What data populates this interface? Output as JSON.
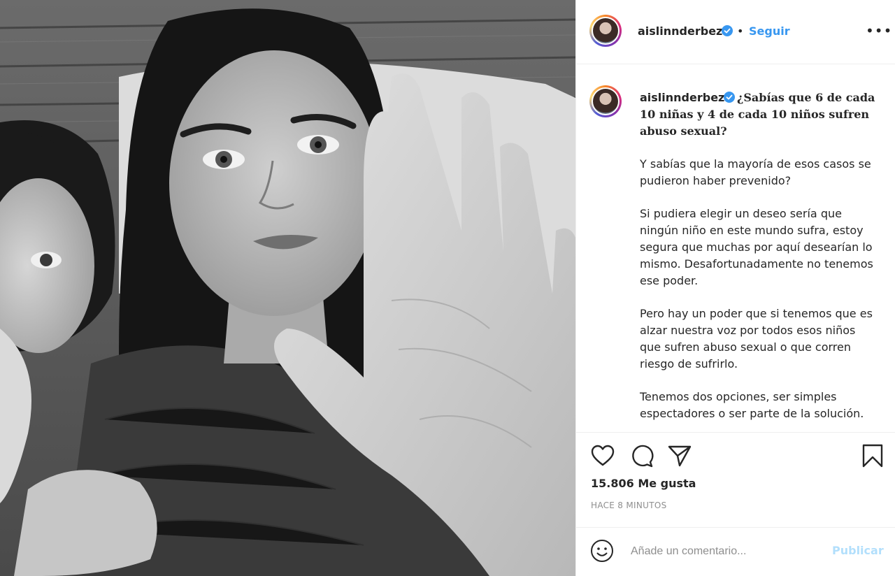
{
  "post": {
    "username": "aislinnderbez",
    "verified": true,
    "follow_label": "Seguir",
    "separator": "•",
    "more_label": "•••"
  },
  "caption": {
    "username": "aislinnderbez",
    "paragraphs": [
      "¿Sabías que 6 de cada 10 niñas y 4 de cada 10 niños sufren abuso sexual?",
      "Y sabías que la mayoría de esos casos se pudieron haber prevenido?",
      "Si pudiera elegir un deseo sería que ningún niño en este mundo sufra, estoy segura que muchas por aquí desearían lo mismo. Desafortunadamente no tenemos ese poder.",
      "Pero hay un poder que si tenemos que es alzar nuestra voz por todos esos niños que sufren abuso sexual o que corren riesgo de sufrirlo.",
      "Tenemos dos opciones, ser simples espectadores o ser parte de la solución."
    ]
  },
  "actions": {
    "like_icon": "heart-icon",
    "comment_icon": "comment-icon",
    "share_icon": "share-icon",
    "save_icon": "bookmark-icon"
  },
  "likes_text": "15.806 Me gusta",
  "timestamp": "HACE 8 MINUTOS",
  "comment": {
    "placeholder": "Añade un comentario...",
    "publish_label": "Publicar",
    "emoji_icon": "emoji-icon"
  },
  "colors": {
    "link_blue": "#3897f0",
    "publish_disabled": "#b2dffc",
    "verified_blue": "#3897f0",
    "muted": "#8e8e8e"
  }
}
